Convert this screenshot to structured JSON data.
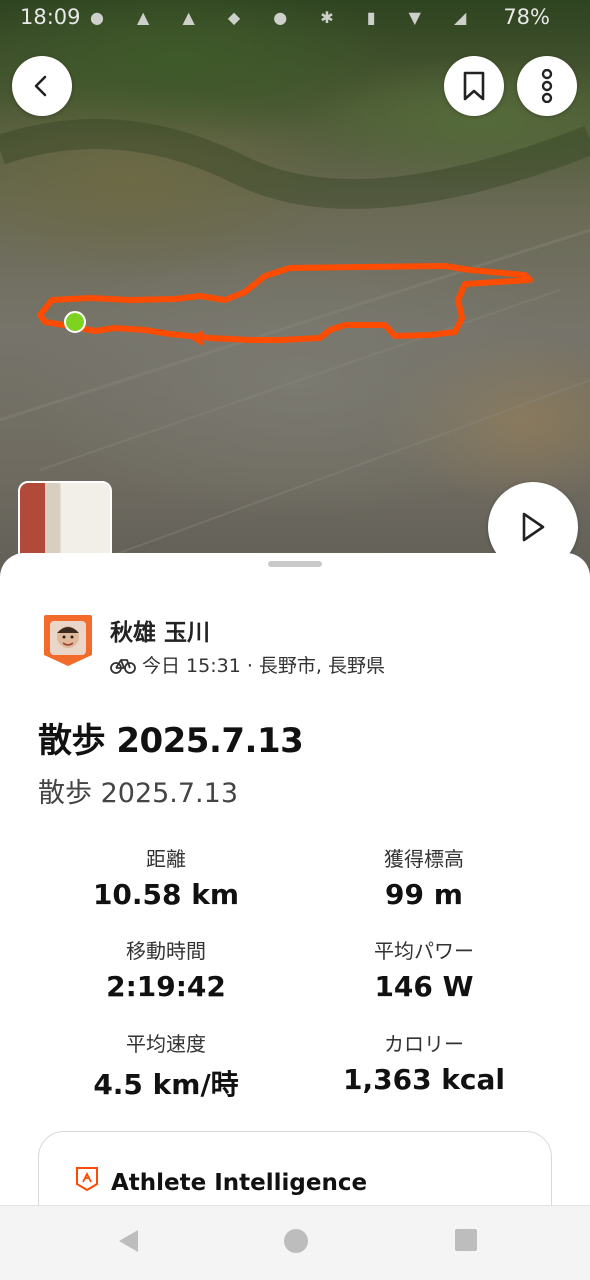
{
  "status_bar": {
    "time": "18:09",
    "battery": "78%"
  },
  "map": {
    "back_icon": "chevron-left-icon",
    "bookmark_icon": "bookmark-icon",
    "more_icon": "more-vertical-icon",
    "play_icon": "play-icon",
    "route_color": "#fc4c02",
    "start_marker_color": "#7ed321"
  },
  "athlete": {
    "name": "秋雄 玉川",
    "sport_icon": "bicycle-icon",
    "meta": "今日 15:31 · 長野市, 長野県"
  },
  "activity": {
    "title": "散歩 2025.7.13",
    "description": "散歩 2025.7.13"
  },
  "stats": [
    {
      "label": "距離",
      "value": "10.58 km"
    },
    {
      "label": "獲得標高",
      "value": "99 m"
    },
    {
      "label": "移動時間",
      "value": "2:19:42"
    },
    {
      "label": "平均パワー",
      "value": "146 W"
    },
    {
      "label": "平均速度",
      "value": "4.5 km/時"
    },
    {
      "label": "カロリー",
      "value": "1,363 kcal"
    }
  ],
  "athlete_intelligence": {
    "title": "Athlete Intelligence"
  },
  "nav": {
    "back": "triangle-back-icon",
    "home": "circle-home-icon",
    "recents": "square-recents-icon"
  }
}
